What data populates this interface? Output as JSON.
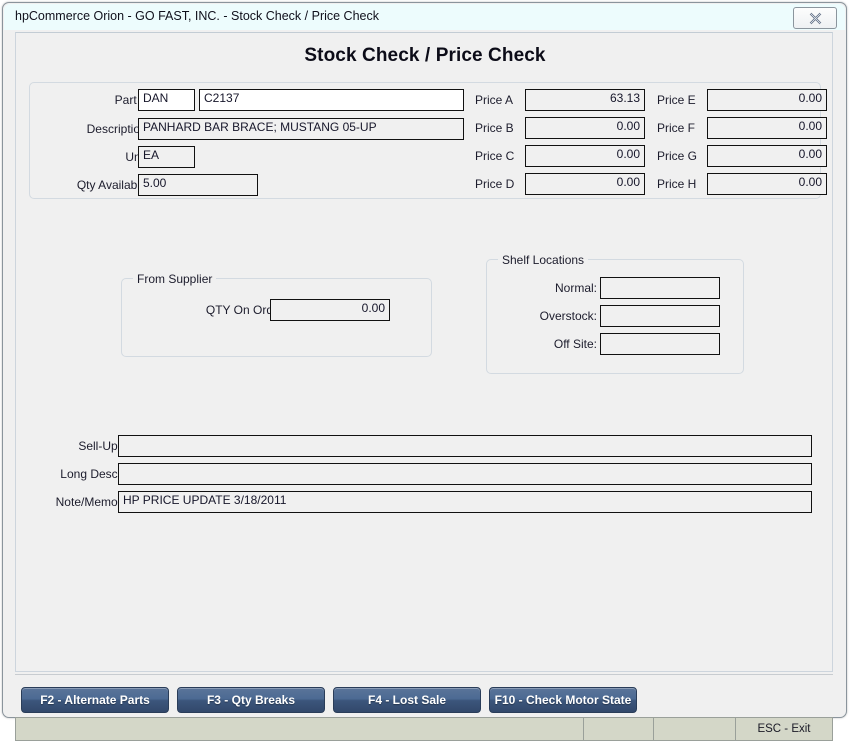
{
  "window": {
    "title": "hpCommerce Orion - GO FAST, INC. - Stock Check / Price Check",
    "close_icon": "close-x-icon"
  },
  "page": {
    "title": "Stock Check / Price Check"
  },
  "part_info": {
    "part_label": "Part #:",
    "part_prefix_value": "DAN",
    "part_number_value": "C2137",
    "description_label": "Description:",
    "description_value": "PANHARD BAR BRACE; MUSTANG 05-UP",
    "unit_label": "Unit:",
    "unit_value": "EA",
    "qty_available_label": "Qty Available:",
    "qty_available_value": "5.00"
  },
  "prices_left": [
    {
      "label": "Price A",
      "value": "63.13"
    },
    {
      "label": "Price B",
      "value": "0.00"
    },
    {
      "label": "Price C",
      "value": "0.00"
    },
    {
      "label": "Price D",
      "value": "0.00"
    }
  ],
  "prices_right": [
    {
      "label": "Price E",
      "value": "0.00"
    },
    {
      "label": "Price F",
      "value": "0.00"
    },
    {
      "label": "Price G",
      "value": "0.00"
    },
    {
      "label": "Price H",
      "value": "0.00"
    }
  ],
  "from_supplier": {
    "caption": "From Supplier",
    "qty_on_order_label": "QTY On Order:",
    "qty_on_order_value": "0.00"
  },
  "shelf_locations": {
    "caption": "Shelf Locations",
    "normal_label": "Normal:",
    "normal_value": "",
    "overstock_label": "Overstock:",
    "overstock_value": "",
    "off_site_label": "Off Site:",
    "off_site_value": ""
  },
  "notes": {
    "sell_up_label": "Sell-Up:",
    "sell_up_value": "",
    "long_desc_label": "Long Desc:",
    "long_desc_value": "",
    "note_memo_label": "Note/Memo:",
    "note_memo_value": "HP PRICE UPDATE 3/18/2011"
  },
  "function_buttons": [
    {
      "label": "F2 - Alternate Parts"
    },
    {
      "label": "F3 - Qty Breaks"
    },
    {
      "label": "F4 - Lost Sale"
    },
    {
      "label": "F10 - Check Motor State"
    }
  ],
  "statusbar": {
    "cell1": "",
    "cell2": "",
    "cell3": "",
    "cell4": "ESC - Exit"
  },
  "colors": {
    "titlebar_bg": "#edfcfd",
    "window_bg": "#f0f0f0",
    "button_blue": "#4c6a93",
    "statusbar_bg": "#d4d7c8",
    "field_border": "#111111"
  }
}
